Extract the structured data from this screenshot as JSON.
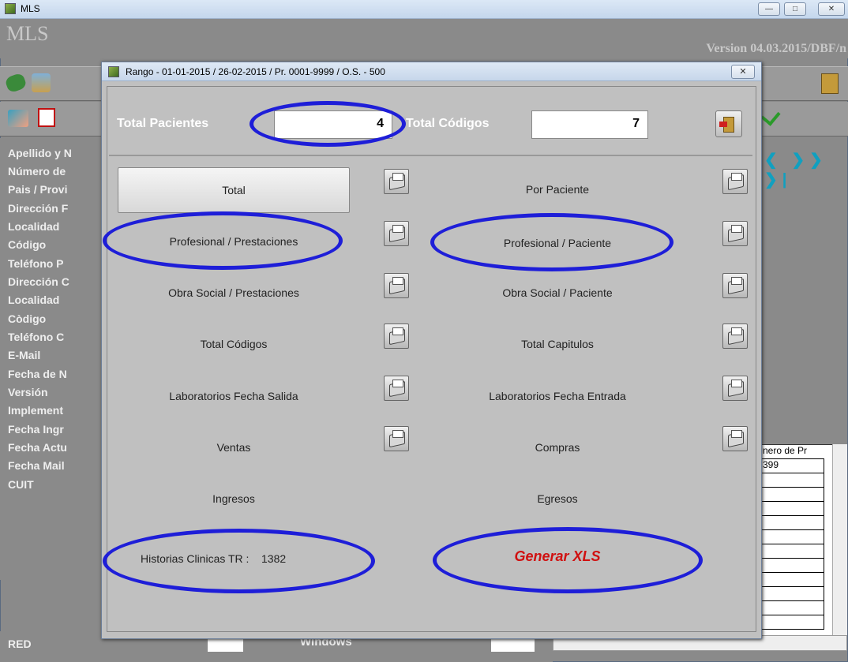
{
  "main_window": {
    "title": "MLS",
    "banner_title": "MLS",
    "version": "Version 04.03.2015/DBF/n",
    "min_glyph": "—",
    "max_glyph": "□",
    "close_glyph": "✕"
  },
  "left_labels": [
    "Apellido y N",
    "Número de",
    "Pais / Provi",
    "Dirección F",
    "Localidad",
    "Código",
    "Teléfono P",
    "Dirección C",
    "Localidad",
    "Còdigo",
    "Teléfono C",
    "E-Mail",
    "Fecha de N",
    "Versión",
    "Implement",
    "Fecha Ingr",
    "Fecha Actu",
    "Fecha Mail",
    "CUIT"
  ],
  "bottom_bar": {
    "red_label": "RED",
    "windows_label": "Windows"
  },
  "right_grid": {
    "header": "nero de Pr",
    "first_value": "399"
  },
  "dialog": {
    "title": "Rango  - 01-01-2015 / 26-02-2015 / Pr. 0001-9999 / O.S.   - 500",
    "close_glyph": "✕",
    "total_pacientes_label": "Total Pacientes",
    "total_pacientes_value": "4",
    "total_codigos_label": "Total Códigos",
    "total_codigos_value": "7",
    "buttons_left": [
      "Total",
      "Profesional / Prestaciones",
      "Obra Social / Prestaciones",
      "Total Códigos",
      "Laboratorios Fecha Salida",
      "Ventas",
      "Ingresos"
    ],
    "buttons_right": [
      "Por Paciente",
      "Profesional / Paciente",
      "Obra Social / Paciente",
      "Total Capitulos",
      "Laboratorios Fecha Entrada",
      "Compras",
      "Egresos"
    ],
    "historias_label": "Historias Clinicas TR :",
    "historias_value": "1382",
    "generar_xls": "Generar XLS"
  },
  "colors": {
    "annotation_ellipse": "#1e1ed8",
    "generar_xls": "#d01010"
  },
  "icons": [
    "printer-icon",
    "exit-door-icon",
    "app-icon"
  ]
}
